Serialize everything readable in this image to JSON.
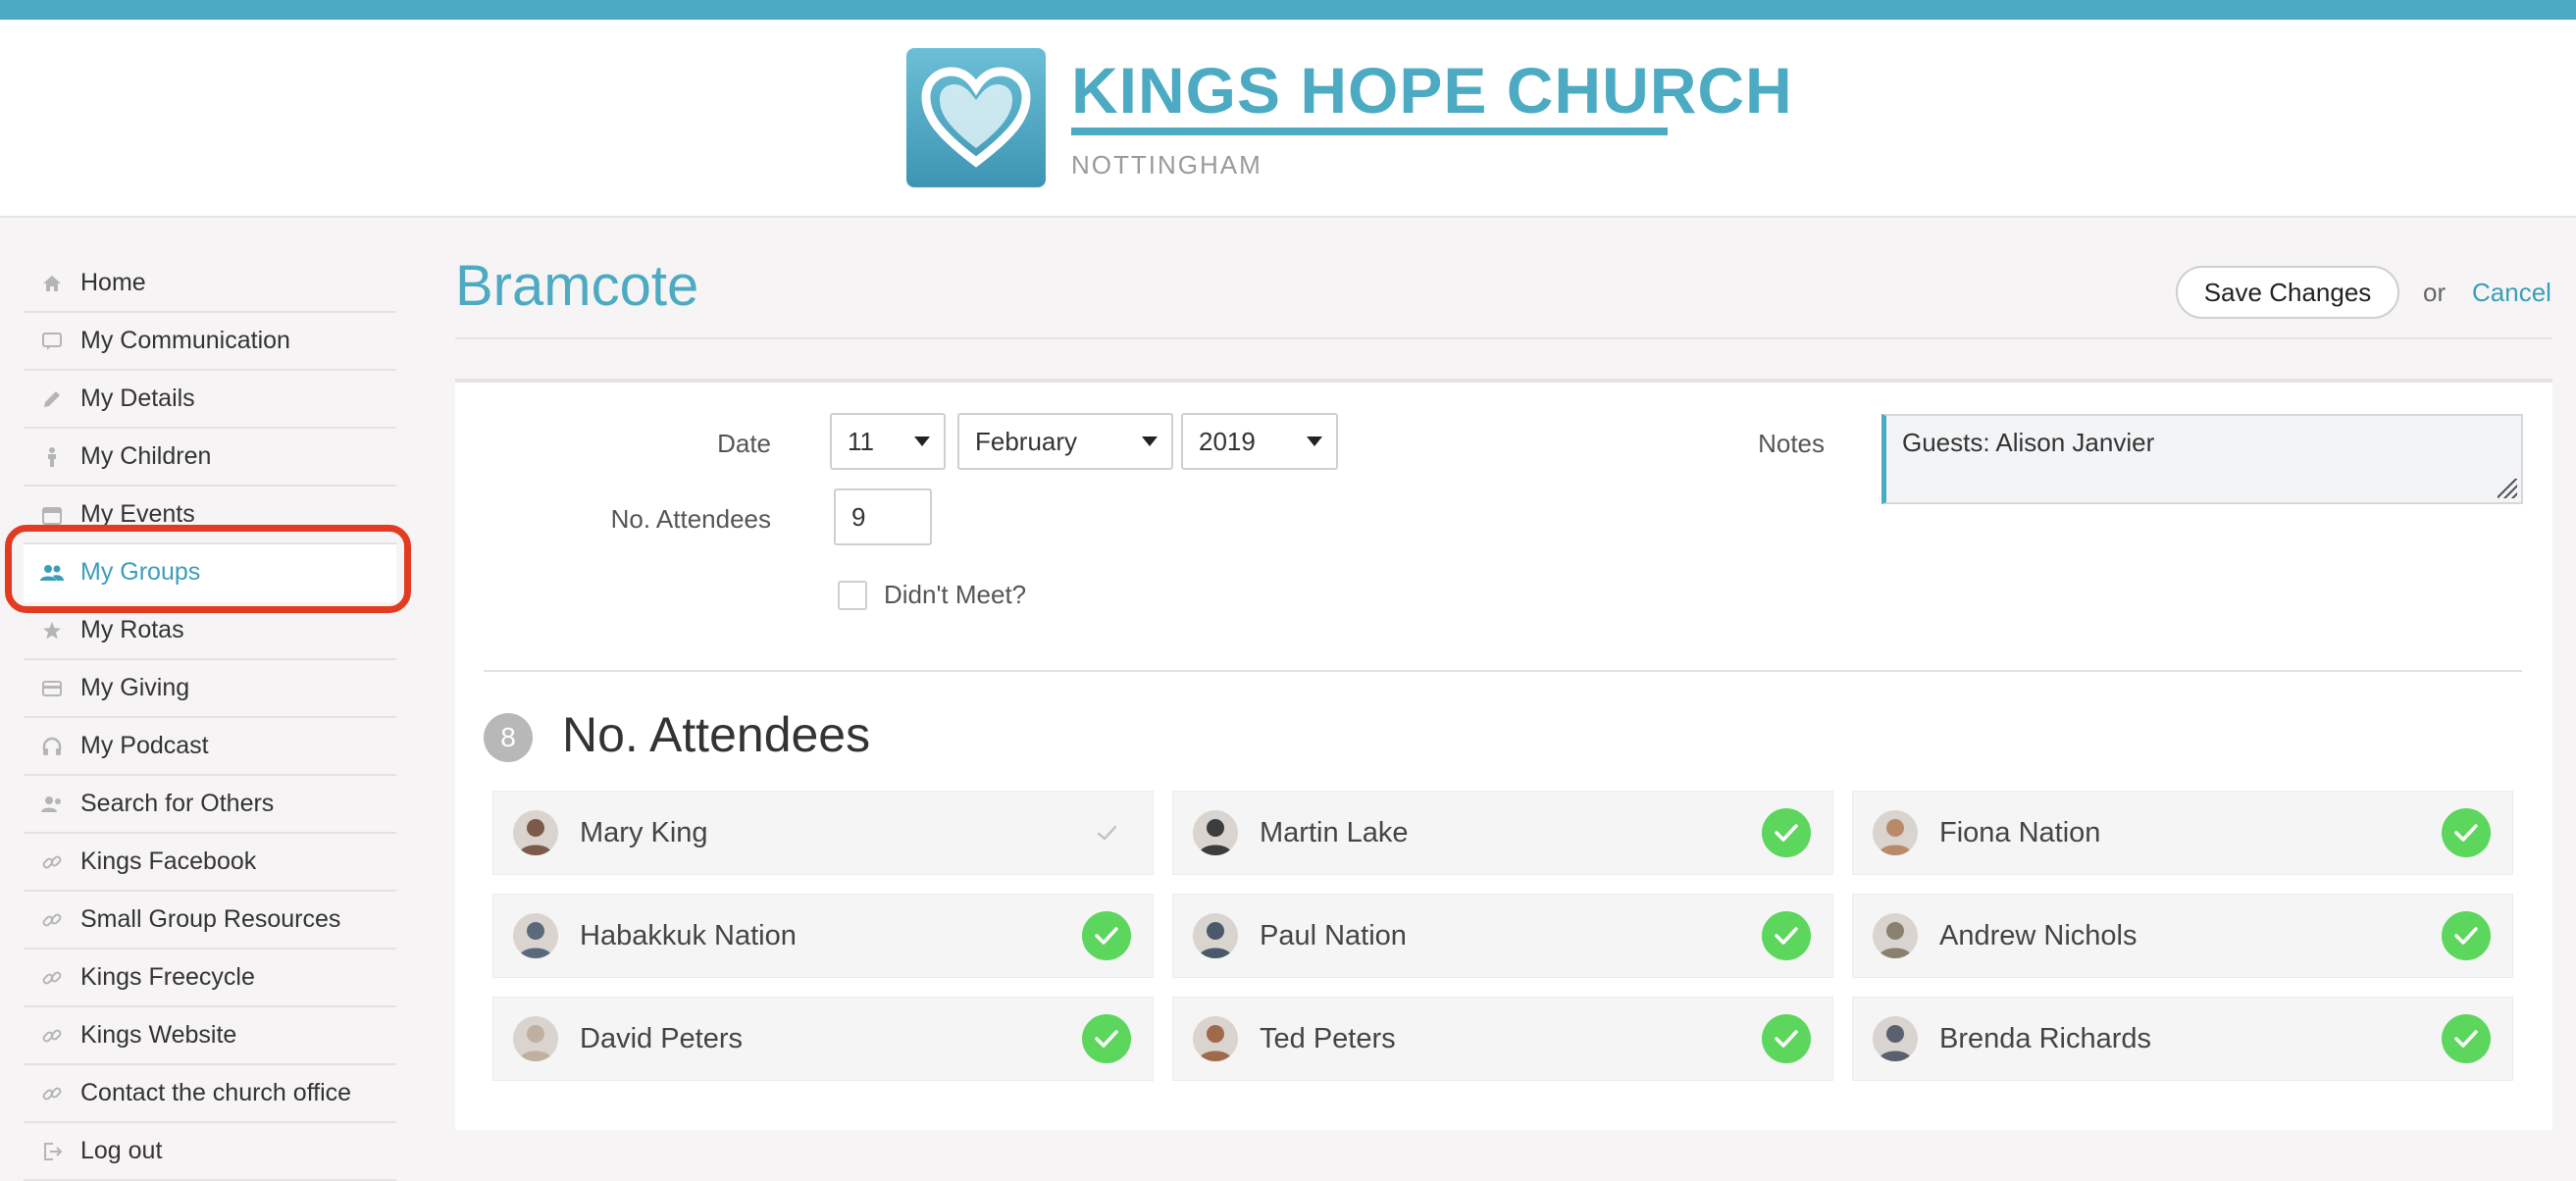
{
  "brand": {
    "title": "KINGS HOPE CHURCH",
    "subtitle": "NOTTINGHAM",
    "accent_color": "#4cabc3"
  },
  "sidebar": {
    "items": [
      {
        "label": "Home",
        "icon": "home-icon"
      },
      {
        "label": "My Communication",
        "icon": "chat-icon"
      },
      {
        "label": "My Details",
        "icon": "pencil-icon"
      },
      {
        "label": "My Children",
        "icon": "child-icon"
      },
      {
        "label": "My Events",
        "icon": "calendar-icon"
      },
      {
        "label": "My Groups",
        "icon": "group-icon",
        "active": true
      },
      {
        "label": "My Rotas",
        "icon": "star-icon"
      },
      {
        "label": "My Giving",
        "icon": "card-icon"
      },
      {
        "label": "My Podcast",
        "icon": "headphones-icon"
      },
      {
        "label": "Search for Others",
        "icon": "people-search-icon"
      },
      {
        "label": "Kings Facebook",
        "icon": "link-icon"
      },
      {
        "label": "Small Group Resources",
        "icon": "link-icon"
      },
      {
        "label": "Kings Freecycle",
        "icon": "link-icon"
      },
      {
        "label": "Kings Website",
        "icon": "link-icon"
      },
      {
        "label": "Contact the church office",
        "icon": "link-icon"
      },
      {
        "label": "Log out",
        "icon": "logout-icon"
      }
    ]
  },
  "page": {
    "title": "Bramcote",
    "save_label": "Save Changes",
    "or_text": "or",
    "cancel_label": "Cancel"
  },
  "form": {
    "date_label": "Date",
    "day": "11",
    "month": "February",
    "year": "2019",
    "attendees_label": "No. Attendees",
    "attendees_value": "9",
    "didnt_meet_label": "Didn't Meet?",
    "didnt_meet_checked": false,
    "notes_label": "Notes",
    "notes_value": "Guests: Alison Janvier"
  },
  "attendance": {
    "count": "8",
    "title": "No. Attendees",
    "members": [
      {
        "name": "Mary King",
        "present": false
      },
      {
        "name": "Martin Lake",
        "present": true
      },
      {
        "name": "Fiona Nation",
        "present": true
      },
      {
        "name": "Habakkuk Nation",
        "present": true
      },
      {
        "name": "Paul Nation",
        "present": true
      },
      {
        "name": "Andrew Nichols",
        "present": true
      },
      {
        "name": "David Peters",
        "present": true
      },
      {
        "name": "Ted Peters",
        "present": true
      },
      {
        "name": "Brenda Richards",
        "present": true
      }
    ]
  }
}
